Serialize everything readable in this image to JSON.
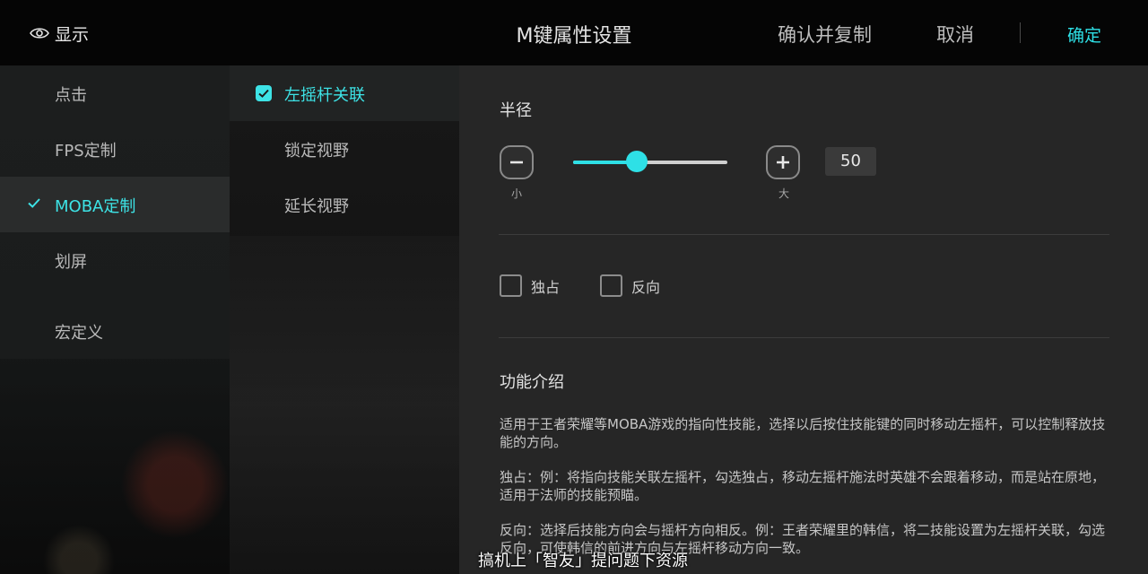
{
  "topbar": {
    "show_label": "显示",
    "title": "M键属性设置",
    "confirm_copy": "确认并复制",
    "cancel": "取消",
    "ok": "确定"
  },
  "categories": [
    {
      "label": "点击"
    },
    {
      "label": "FPS定制"
    },
    {
      "label": "MOBA定制"
    },
    {
      "label": "划屏"
    },
    {
      "label": "宏定义"
    }
  ],
  "sub_options": [
    {
      "label": "左摇杆关联"
    },
    {
      "label": "锁定视野"
    },
    {
      "label": "延长视野"
    }
  ],
  "radius": {
    "title": "半径",
    "min_label": "小",
    "max_label": "大",
    "value": "50",
    "slider_fraction": 0.41
  },
  "options": {
    "exclusive": "独占",
    "reverse": "反向"
  },
  "intro": {
    "title": "功能介绍",
    "p1": "适用于王者荣耀等MOBA游戏的指向性技能，选择以后按住技能键的同时移动左摇杆，可以控制释放技能的方向。",
    "p2": "独占：例：将指向技能关联左摇杆，勾选独占，移动左摇杆施法时英雄不会跟着移动，而是站在原地，适用于法师的技能预瞄。",
    "p3": "反向：选择后技能方向会与摇杆方向相反。例：王者荣耀里的韩信，将二技能设置为左摇杆关联，勾选反向，可使韩信的前进方向与左摇杆移动方向一致。"
  },
  "watermark": "搞机上「智友」提问题下资源",
  "colors": {
    "accent": "#2ee0e6",
    "topbar_bg": "#050505",
    "panel_bg": "#262626"
  }
}
